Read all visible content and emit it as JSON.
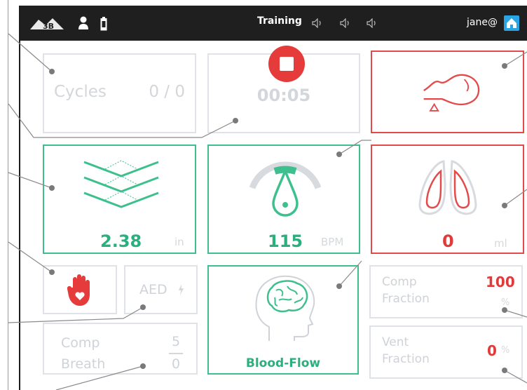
{
  "topbar": {
    "mode": "Training",
    "user": "jane@",
    "icons": [
      "3b-logo-icon",
      "person-icon",
      "battery-icon",
      "speaker-icon",
      "speaker-icon",
      "speaker-icon",
      "home-icon"
    ]
  },
  "cycles": {
    "label": "Cycles",
    "value": "0 / 0"
  },
  "timer": {
    "value": "00:05"
  },
  "depth": {
    "value": "2.38",
    "unit": "in"
  },
  "rate": {
    "value": "115",
    "unit": "BPM"
  },
  "volume": {
    "value": "0",
    "unit": "ml"
  },
  "aed": {
    "label": "AED"
  },
  "blood_flow": {
    "label": "Blood-Flow"
  },
  "comp_fraction": {
    "label_line1": "Comp",
    "label_line2": "Fraction",
    "value": "100",
    "unit": "%"
  },
  "vent_fraction": {
    "label_line1": "Vent",
    "label_line2": "Fraction",
    "value": "0",
    "unit": "%"
  },
  "comp_breath": {
    "label_line1": "Comp",
    "label_line2": "Breath",
    "comp_value": "5",
    "breath_value": "0"
  },
  "colors": {
    "green": "#3ebf8e",
    "red": "#e34b4b",
    "gray_border": "#dfe2e6",
    "topbar": "#1f1f1f",
    "home": "#2aa5e3"
  }
}
